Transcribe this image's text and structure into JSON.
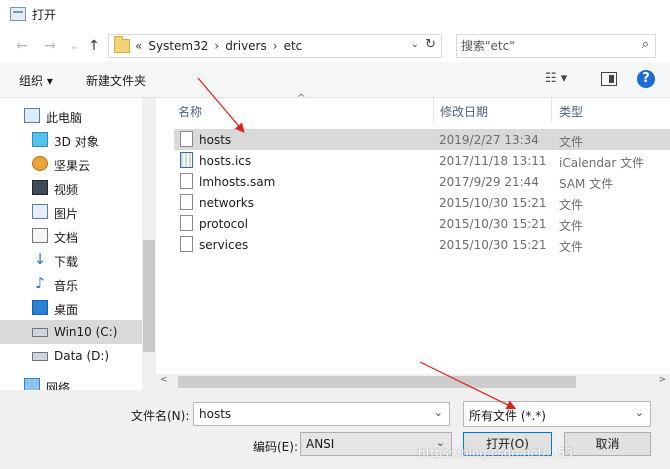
{
  "window": {
    "title": "打开"
  },
  "nav_buttons": {
    "back": "←",
    "forward": "→",
    "recent": "⌄",
    "up": "↑"
  },
  "address": {
    "crumbs": [
      "«",
      "System32",
      "›",
      "drivers",
      "›",
      "etc"
    ],
    "dropdown": "⌄",
    "refresh": "↻"
  },
  "search": {
    "placeholder": "搜索\"etc\"",
    "icon": "⌕"
  },
  "toolbar": {
    "organize": "组织 ▾",
    "new_folder": "新建文件夹",
    "view": "☷ ▾",
    "help": "?"
  },
  "sidebar": {
    "items": [
      {
        "label": "此电脑",
        "icon": "computer-icon"
      },
      {
        "label": "3D 对象",
        "icon": "cube-icon"
      },
      {
        "label": "坚果云",
        "icon": "nut-icon"
      },
      {
        "label": "视频",
        "icon": "video-icon"
      },
      {
        "label": "图片",
        "icon": "picture-icon"
      },
      {
        "label": "文档",
        "icon": "document-icon"
      },
      {
        "label": "下载",
        "icon": "download-icon"
      },
      {
        "label": "音乐",
        "icon": "music-icon"
      },
      {
        "label": "桌面",
        "icon": "desktop-icon"
      },
      {
        "label": "Win10 (C:)",
        "icon": "drive-icon",
        "selected": true
      },
      {
        "label": "Data (D:)",
        "icon": "drive-icon"
      },
      {
        "label": "网络",
        "icon": "network-icon"
      }
    ]
  },
  "columns": {
    "name": "名称",
    "date": "修改日期",
    "type": "类型",
    "sort": "^"
  },
  "files": [
    {
      "name": "hosts",
      "date": "2019/2/27 13:34",
      "type": "文件",
      "icon": "file-icon",
      "selected": true
    },
    {
      "name": "hosts.ics",
      "date": "2017/11/18 13:11",
      "type": "iCalendar 文件",
      "icon": "calendar-file-icon"
    },
    {
      "name": "lmhosts.sam",
      "date": "2017/9/29 21:44",
      "type": "SAM 文件",
      "icon": "file-icon"
    },
    {
      "name": "networks",
      "date": "2015/10/30 15:21",
      "type": "文件",
      "icon": "file-icon"
    },
    {
      "name": "protocol",
      "date": "2015/10/30 15:21",
      "type": "文件",
      "icon": "file-icon"
    },
    {
      "name": "services",
      "date": "2015/10/30 15:21",
      "type": "文件",
      "icon": "file-icon"
    }
  ],
  "scroll": {
    "left": "<",
    "right": ">"
  },
  "bottom": {
    "filename_label": "文件名(N):",
    "filename_value": "hosts",
    "filetype_value": "所有文件  (*.*)",
    "encoding_label": "编码(E):",
    "encoding_value": "ANSI",
    "open_button": "打开(O)",
    "cancel_button": "取消",
    "chevron": "⌄"
  },
  "watermark": "https://blog.csdn.net/...53",
  "colors": {
    "arrow": "#e0201b",
    "selection": "#d9d9d9",
    "accent": "#0078d7"
  }
}
